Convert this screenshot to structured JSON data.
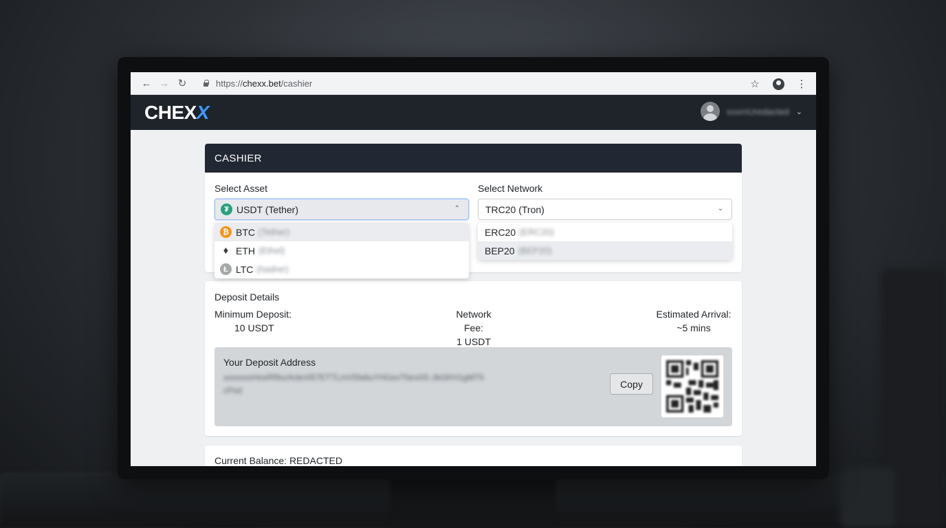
{
  "browser": {
    "url_protocol": "https://",
    "url_host": "chexx.bet",
    "url_path": "/cashier"
  },
  "site": {
    "logo_main": "CHEX",
    "logo_accent": "X",
    "username": "xxxrnUredacted"
  },
  "cashier": {
    "title": "CASHIER",
    "asset_label": "Select Asset",
    "asset_selected": "USDT (Tether)",
    "asset_options": [
      {
        "code": "BTC",
        "name": "(Tether)",
        "icon": "bitcoin-icon"
      },
      {
        "code": "ETH",
        "name": "(Ethel)",
        "icon": "ethereum-icon"
      },
      {
        "code": "LTC",
        "name": "(hadrer)",
        "icon": "litecoin-icon"
      }
    ],
    "network_label": "Select Network",
    "network_selected": "TRC20 (Tron)",
    "network_options": [
      {
        "code": "ERC20",
        "name": "(ERC20)"
      },
      {
        "code": "BEP20",
        "name": "(BEP20)"
      }
    ]
  },
  "details": {
    "title": "Deposit Details",
    "min_label": "Minimum Deposit:",
    "min_value": "10 USDT",
    "fee_label": "Network Fee:",
    "fee_value": "1 USDT",
    "arrival_label": "Estimated Arrival:",
    "arrival_value": "~5 mins",
    "address_label": "Your Deposit Address",
    "address_value": "xxxxxxxHeeRf9urAnkn057ETTLmV5fa6uYHGexTfarx0S-JbGKH1gMT5cPxd",
    "copy_label": "Copy"
  },
  "balance": {
    "text": "Current Balance: REDACTED"
  },
  "colors": {
    "header_bg": "#1f232a",
    "logo_accent": "#3d9bff",
    "usdt": "#26a17b",
    "btc": "#f7931a"
  }
}
